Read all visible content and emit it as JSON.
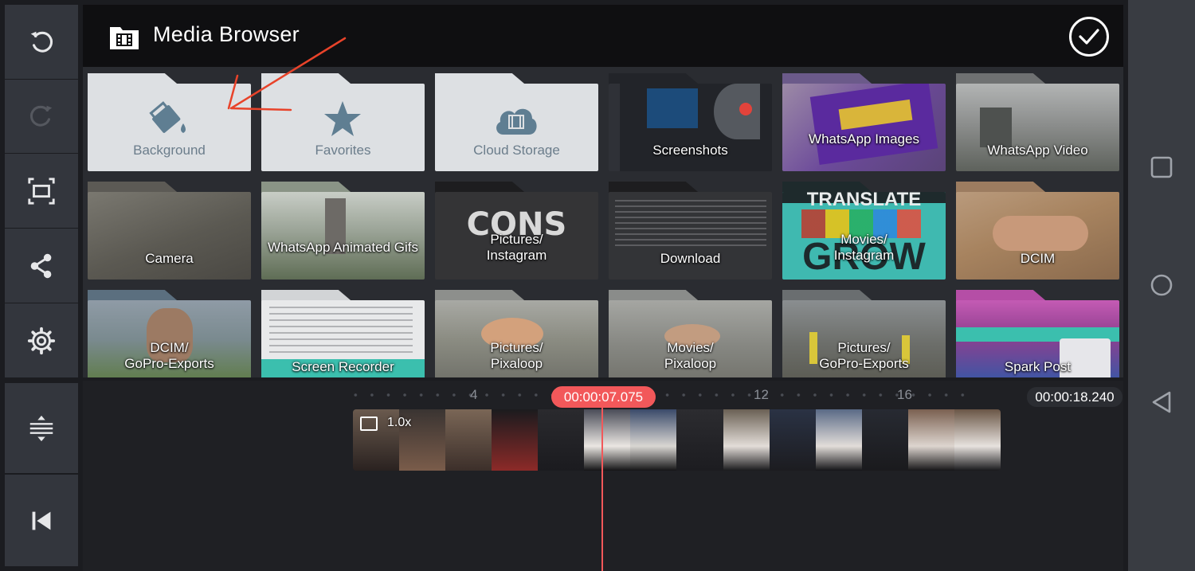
{
  "header": {
    "title": "Media Browser",
    "title_icon": "film-folder-icon",
    "confirm_icon": "check-circle-icon"
  },
  "left_toolbar": {
    "items": [
      {
        "name": "undo-icon",
        "enabled": true
      },
      {
        "name": "redo-icon",
        "enabled": false
      },
      {
        "name": "aspect-ratio-icon",
        "enabled": true
      },
      {
        "name": "share-icon",
        "enabled": true
      },
      {
        "name": "settings-gear-icon",
        "enabled": true
      }
    ],
    "bottom_items": [
      {
        "name": "timeline-resize-icon"
      },
      {
        "name": "skip-to-start-icon"
      }
    ]
  },
  "folders": [
    {
      "label": "Background",
      "icon": "paint-bucket-icon"
    },
    {
      "label": "Favorites",
      "icon": "star-icon"
    },
    {
      "label": "Cloud Storage",
      "icon": "cloud-film-icon"
    },
    {
      "label": "Screenshots"
    },
    {
      "label": "WhatsApp Images"
    },
    {
      "label": "WhatsApp Video"
    },
    {
      "label": "Camera"
    },
    {
      "label": "WhatsApp Animated Gifs"
    },
    {
      "label": "Pictures/\nInstagram",
      "thumb_text": "CONS"
    },
    {
      "label": "Download"
    },
    {
      "label": "Movies/\nInstagram",
      "thumb_text_top": "TRANSLATE",
      "thumb_text_bottom": "GROW"
    },
    {
      "label": "DCIM"
    },
    {
      "label": "DCIM/\nGoPro-Exports"
    },
    {
      "label": "Screen Recorder"
    },
    {
      "label": "Pictures/\nPixaloop"
    },
    {
      "label": "Movies/\nPixaloop"
    },
    {
      "label": "Pictures/\nGoPro-Exports"
    },
    {
      "label": "Spark Post"
    }
  ],
  "timeline": {
    "current_time": "00:00:07.075",
    "total_time": "00:00:18.240",
    "ruler_labels": [
      "4",
      "12",
      "16"
    ],
    "clip_speed": "1.0x",
    "clip_icon": "film-strip-icon"
  },
  "android_nav": [
    "recents-square-icon",
    "home-circle-icon",
    "back-triangle-icon"
  ],
  "colors": {
    "accent": "#f2585a",
    "annotation_arrow": "#e8432a",
    "light_folder": "#dde0e3",
    "folder_icon": "#5f7e92"
  }
}
